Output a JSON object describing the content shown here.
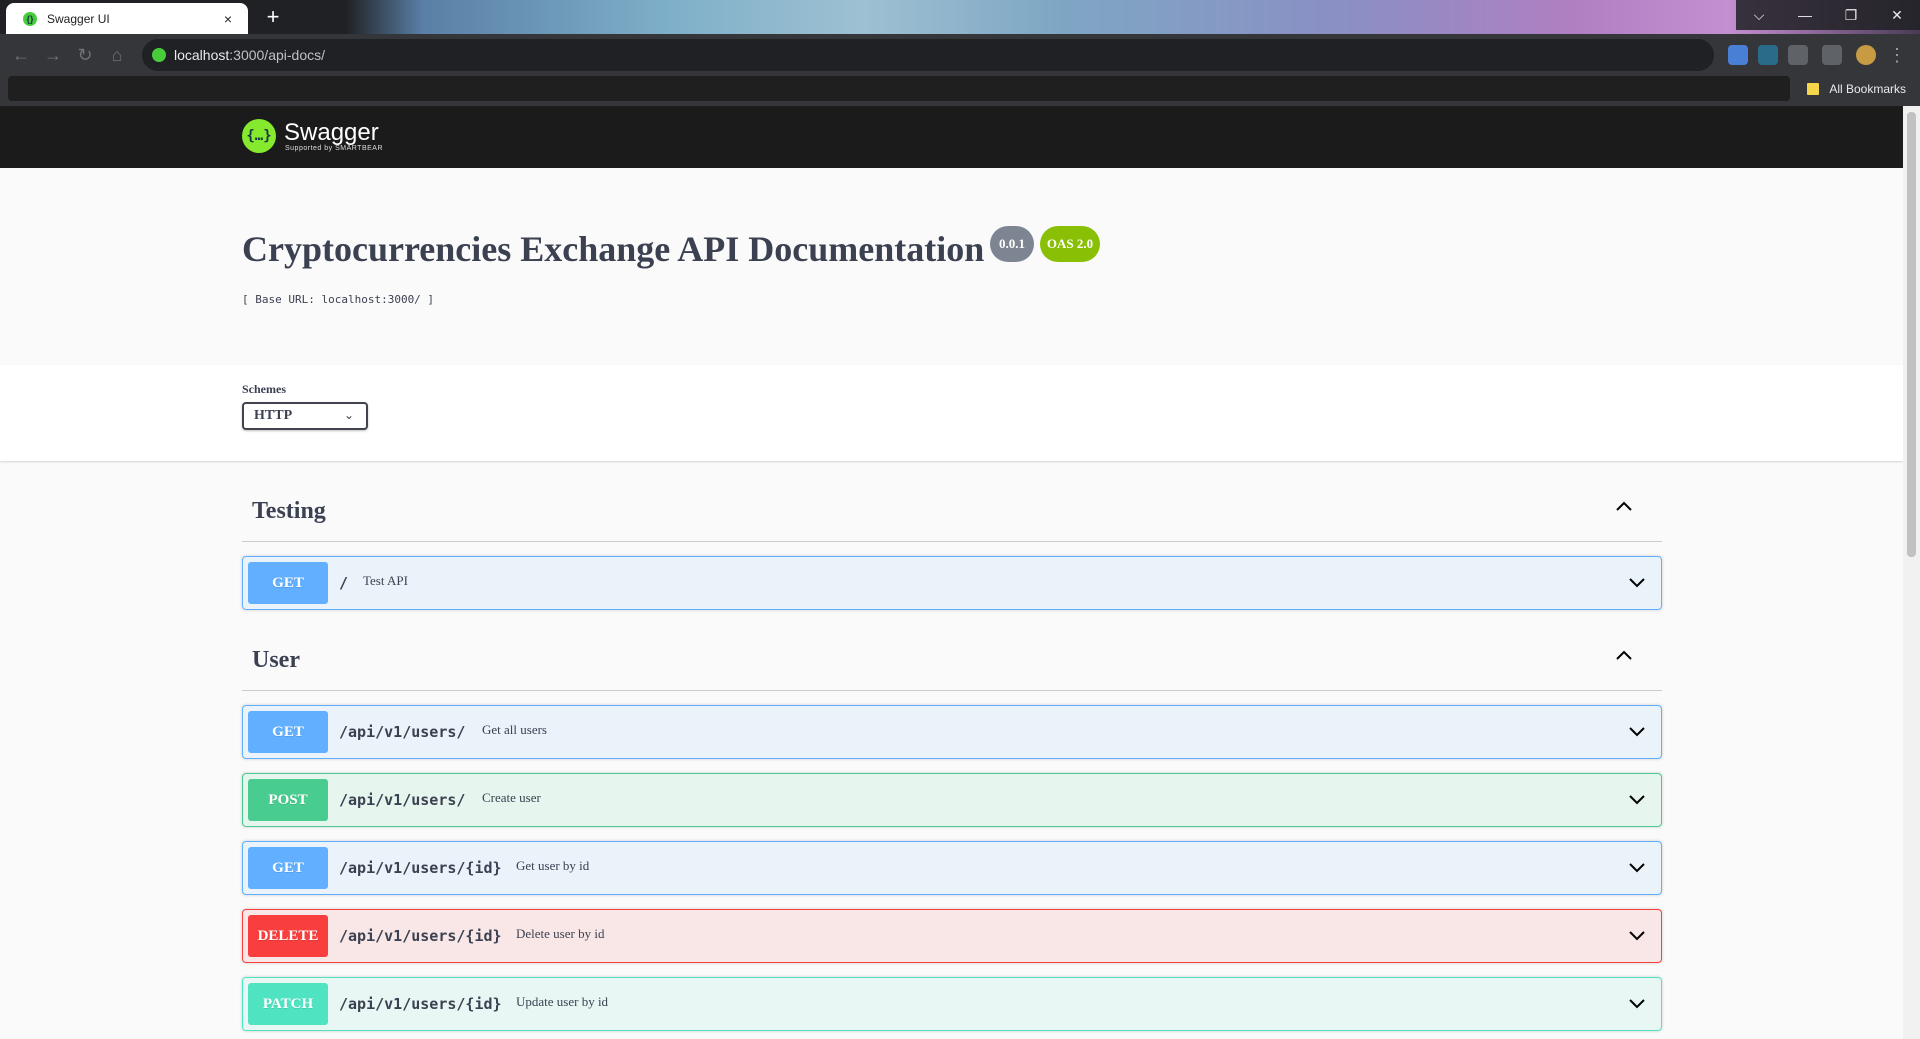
{
  "browser": {
    "tab_title": "Swagger UI",
    "tab_close": "×",
    "new_tab": "+",
    "url_host": "localhost",
    "url_rest": ":3000/api-docs/",
    "all_bookmarks": "All Bookmarks",
    "window_controls": {
      "tabsearch": "⌵",
      "minimize": "—",
      "restore": "❐",
      "close": "✕"
    }
  },
  "header": {
    "logo_text": "Swagger",
    "logo_glyph": "{…}",
    "logo_tagline": "Supported by SMARTBEAR"
  },
  "info": {
    "title": "Cryptocurrencies Exchange API Documentation",
    "version": "0.0.1",
    "oas": "OAS 2.0",
    "base_url": "[ Base URL: localhost:3000/ ]"
  },
  "schemes": {
    "label": "Schemes",
    "selected": "HTTP"
  },
  "tags": [
    {
      "name": "Testing",
      "operations": [
        {
          "method": "GET",
          "path": "/",
          "summary": "Test API"
        }
      ]
    },
    {
      "name": "User",
      "operations": [
        {
          "method": "GET",
          "path": "/api/v1/users/",
          "summary": "Get all users"
        },
        {
          "method": "POST",
          "path": "/api/v1/users/",
          "summary": "Create user"
        },
        {
          "method": "GET",
          "path": "/api/v1/users/{id}",
          "summary": "Get user by id"
        },
        {
          "method": "DELETE",
          "path": "/api/v1/users/{id}",
          "summary": "Delete user by id"
        },
        {
          "method": "PATCH",
          "path": "/api/v1/users/{id}",
          "summary": "Update user by id"
        }
      ]
    }
  ],
  "colors": {
    "get": "#61affe",
    "post": "#49cc90",
    "delete": "#f93e3e",
    "patch": "#50e3c2",
    "swagger_green": "#85ea2d",
    "text": "#3b4151"
  }
}
